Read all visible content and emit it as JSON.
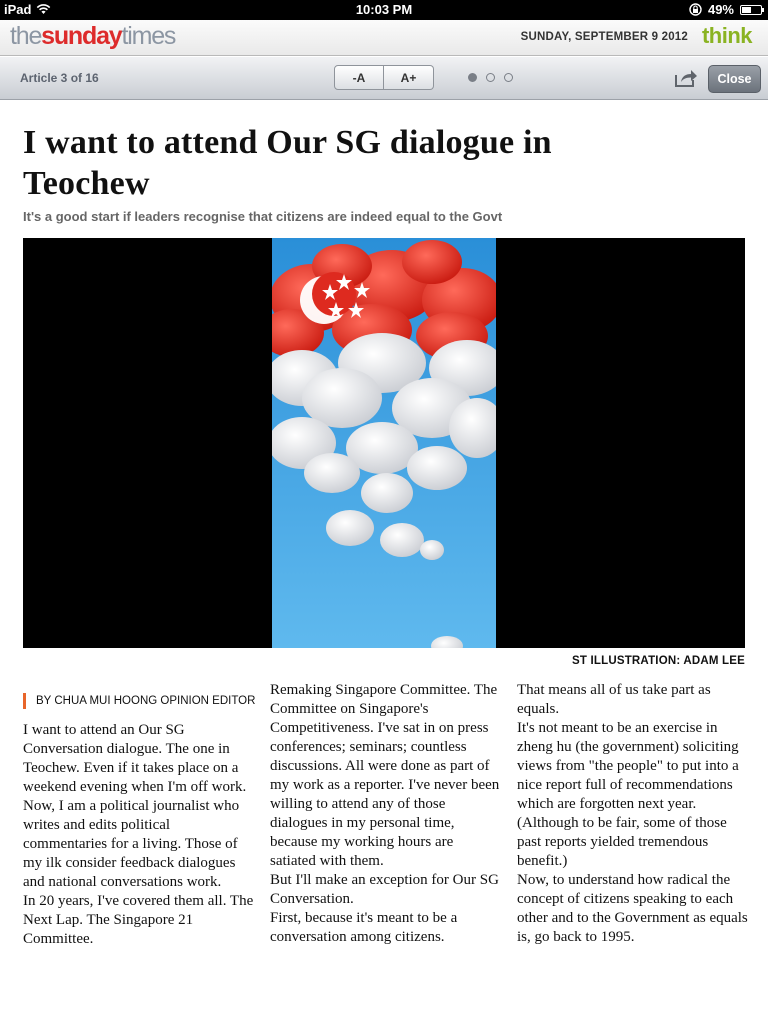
{
  "status_bar": {
    "device": "iPad",
    "time": "10:03 PM",
    "battery": "49%",
    "battery_level": 0.49,
    "wifi_icon": "wifi-icon",
    "lock_icon": "rotation-lock-icon"
  },
  "masthead": {
    "logo_part1": "the",
    "logo_part2": "sunday",
    "logo_part3": "times",
    "date": "SUNDAY, SEPTEMBER 9 2012",
    "section": "think",
    "colors": {
      "logo_red": "#dd2b2b",
      "logo_grey": "#8c96a3",
      "section_green": "#8ab322"
    }
  },
  "toolbar": {
    "article_count": "Article 3 of 16",
    "font_smaller": "-A",
    "font_larger": "A+",
    "page_dots": [
      true,
      false,
      false
    ],
    "share_icon": "share-icon",
    "close_label": "Close"
  },
  "article": {
    "headline": "I want to attend Our SG dialogue in Teochew",
    "subhead": "It's a good start if leaders recognise that citizens are indeed equal to the Govt",
    "image_caption": "ST ILLUSTRATION: ADAM LEE",
    "byline": "BY CHUA MUI HOONG OPINION EDITOR",
    "byline_accent": "#e8652a",
    "columns": [
      {
        "paragraphs": [
          "I want to attend an Our SG Conversation dialogue. The one in Teochew. Even if it takes place on a weekend evening when I'm off work.",
          "Now, I am a political journalist who writes and edits political commentaries for a living. Those of my ilk consider feedback dialogues and national conversations work.",
          "In 20 years, I've covered them all. The Next Lap. The Singapore 21 Committee."
        ]
      },
      {
        "paragraphs": [
          "Remaking Singapore Committee. The Committee on Singapore's Competitiveness. I've sat in on press conferences; seminars; countless discussions. All were done as part of my work as a reporter. I've never been willing to attend any of those dialogues in my personal time, because my working hours are satiated with them.",
          "But I'll make an exception for Our SG Conversation.",
          "First, because it's meant to be a conversation among citizens."
        ]
      },
      {
        "paragraphs": [
          "That means all of us take part as equals.",
          "It's not meant to be an exercise in zheng hu (the government) soliciting views from \"the people\" to put into a nice report full of recommendations which are forgotten next year. (Although to be fair, some of those past reports yielded tremendous benefit.)",
          "Now, to understand how radical the concept of citizens speaking to each other and to the Government as equals is, go back to 1995."
        ]
      }
    ]
  }
}
